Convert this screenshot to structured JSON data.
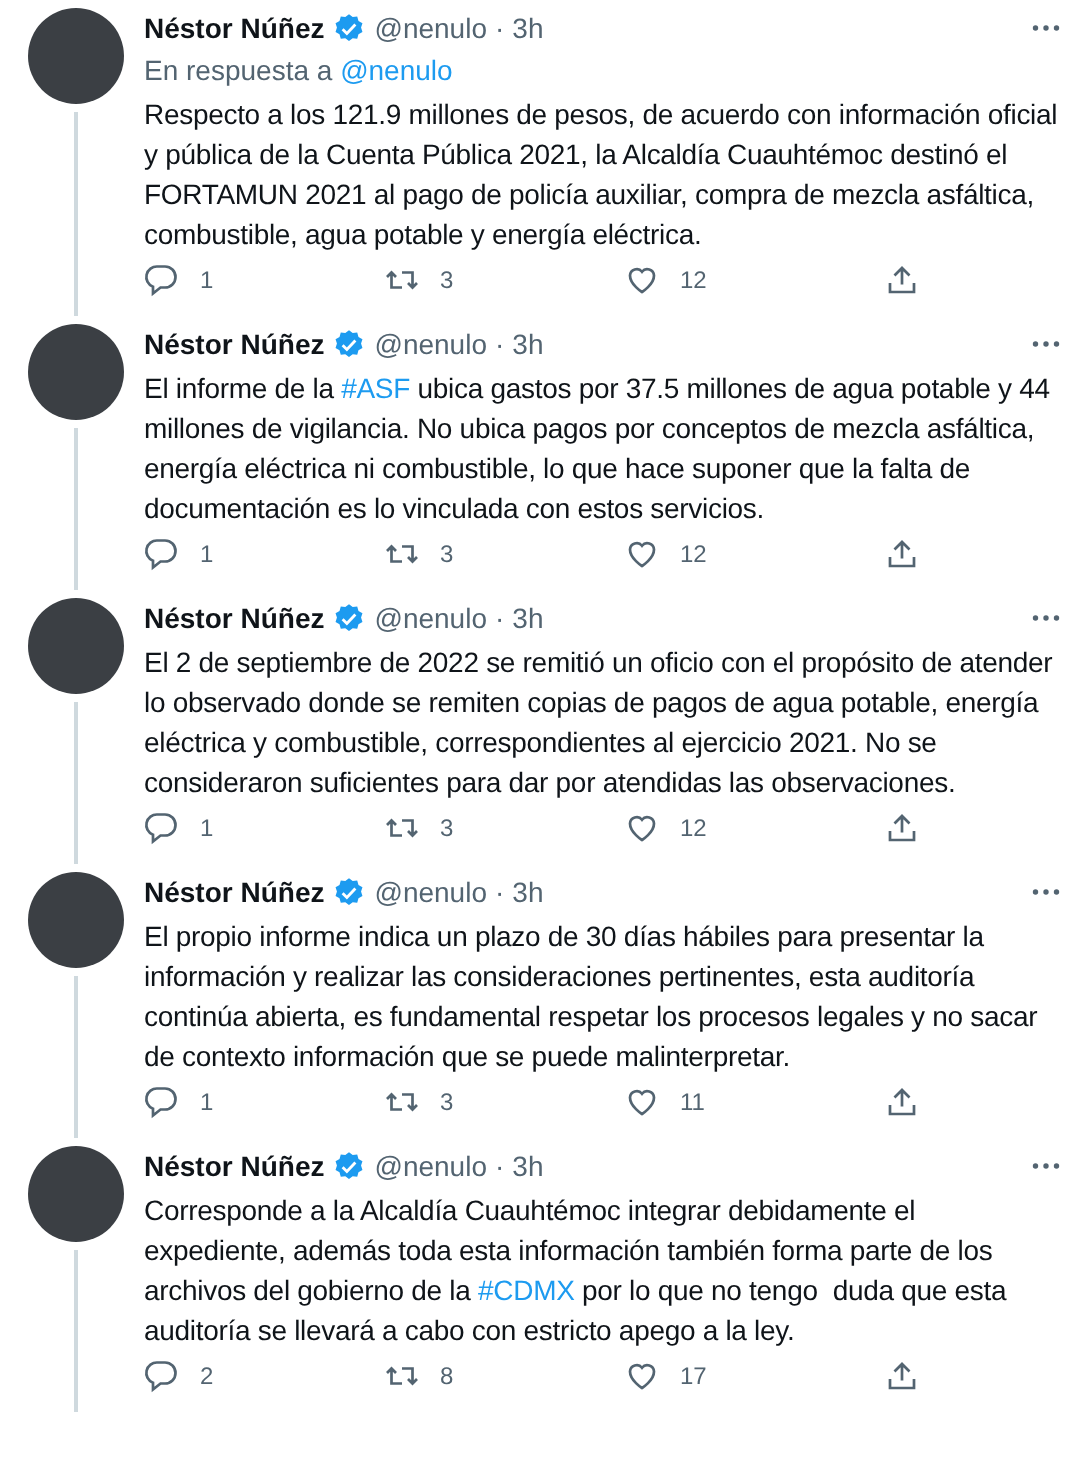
{
  "tweets": [
    {
      "name": "Néstor Núñez",
      "verified": true,
      "handle": "@nenulo",
      "separator": "·",
      "time": "3h",
      "reply_to": [
        {
          "kind": "text",
          "text": "En respuesta a "
        },
        {
          "kind": "link",
          "text": "@nenulo"
        }
      ],
      "body": [
        {
          "kind": "text",
          "text": "Respecto a los 121.9 millones de pesos, de acuerdo con información oficial y pública de la Cuenta Pública 2021, la Alcaldía Cuauhtémoc destinó el FORTAMUN 2021 al pago de policía auxiliar, compra de mezcla asfáltica, combustible, agua potable y energía eléctrica."
        }
      ],
      "replies": "1",
      "retweets": "3",
      "likes": "12"
    },
    {
      "name": "Néstor Núñez",
      "verified": true,
      "handle": "@nenulo",
      "separator": "·",
      "time": "3h",
      "body": [
        {
          "kind": "text",
          "text": "El informe de la "
        },
        {
          "kind": "link",
          "text": "#ASF"
        },
        {
          "kind": "text",
          "text": " ubica gastos por 37.5 millones de agua potable y 44 millones de vigilancia. No ubica pagos por conceptos de mezcla asfáltica, energía eléctrica ni combustible, lo que hace suponer que la falta de documentación es lo vinculada con estos servicios."
        }
      ],
      "replies": "1",
      "retweets": "3",
      "likes": "12"
    },
    {
      "name": "Néstor Núñez",
      "verified": true,
      "handle": "@nenulo",
      "separator": "·",
      "time": "3h",
      "body": [
        {
          "kind": "text",
          "text": "El 2 de septiembre de 2022 se remitió un oficio con el propósito de atender lo observado donde se remiten copias de pagos de agua potable, energía eléctrica y combustible, correspondientes al ejercicio 2021. No se consideraron suficientes para dar por atendidas las observaciones."
        }
      ],
      "replies": "1",
      "retweets": "3",
      "likes": "12"
    },
    {
      "name": "Néstor Núñez",
      "verified": true,
      "handle": "@nenulo",
      "separator": "·",
      "time": "3h",
      "body": [
        {
          "kind": "text",
          "text": "El propio informe indica un plazo de 30 días hábiles para presentar la información y realizar las consideraciones pertinentes, esta auditoría continúa abierta, es fundamental respetar los procesos legales y no sacar de contexto información que se puede malinterpretar."
        }
      ],
      "replies": "1",
      "retweets": "3",
      "likes": "11"
    },
    {
      "name": "Néstor Núñez",
      "verified": true,
      "handle": "@nenulo",
      "separator": "·",
      "time": "3h",
      "body": [
        {
          "kind": "text",
          "text": "Corresponde a la Alcaldía Cuauhtémoc integrar debidamente el expediente, además toda esta información también forma parte de los archivos del gobierno de la "
        },
        {
          "kind": "link",
          "text": "#CDMX"
        },
        {
          "kind": "text",
          "text": " por lo que no tengo  duda que esta auditoría se llevará a cabo con estricto apego a la ley."
        }
      ],
      "replies": "2",
      "retweets": "8",
      "likes": "17"
    }
  ]
}
